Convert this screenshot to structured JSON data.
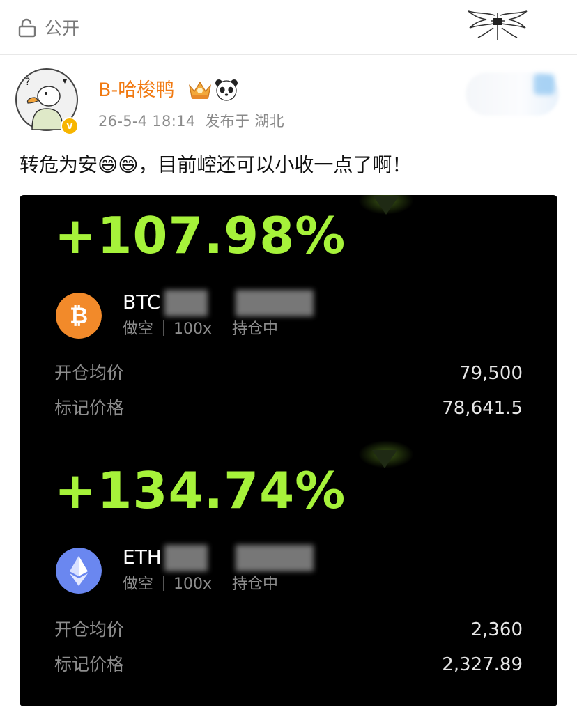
{
  "header": {
    "visibility_label": "公开",
    "lock_icon": "lock-open-icon",
    "emblem_icon": "winged-cross-emblem-icon"
  },
  "post": {
    "username": "B-哈梭鸭",
    "username_color": "#f17a12",
    "crown_icon": "vip-crown-icon",
    "panda_icon": "panda-emoji-icon",
    "meta": "26-5-4 18:14  发布于 湖北",
    "text": "转危为安😄😄，目前崆还可以小收一点了啊！"
  },
  "positions": [
    {
      "pnl": "+107.98%",
      "coin": "BTC",
      "direction": "做空",
      "leverage": "100x",
      "status": "持仓中",
      "open_price_label": "开仓均价",
      "open_price": "79,500",
      "mark_price_label": "标记价格",
      "mark_price": "78,641.5",
      "coin_color": "#f28a2a"
    },
    {
      "pnl": "+134.74%",
      "coin": "ETH",
      "direction": "做空",
      "leverage": "100x",
      "status": "持仓中",
      "open_price_label": "开仓均价",
      "open_price": "2,360",
      "mark_price_label": "标记价格",
      "mark_price": "2,327.89",
      "coin_color": "#6a87f0"
    }
  ],
  "colors": {
    "pnl_green": "#a6f23a",
    "card_bg": "#000000"
  }
}
